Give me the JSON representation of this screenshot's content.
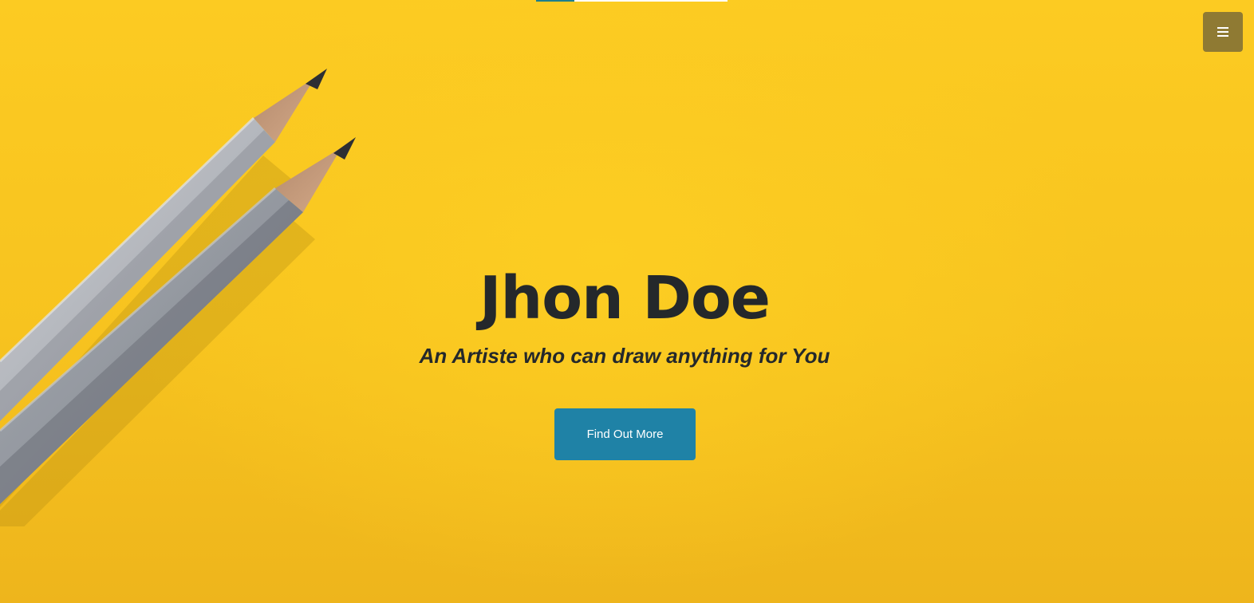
{
  "hero": {
    "title": "Jhon Doe",
    "subtitle": "An Artiste who can draw anything for You",
    "cta_label": "Find Out More",
    "background_image": "yellow-paper-with-two-pencils"
  },
  "nav": {
    "menu_icon": "hamburger-menu-icon"
  },
  "colors": {
    "background": "#f8c51f",
    "text": "#24282b",
    "cta": "#1f82a6",
    "menu_button": "#8f7a33"
  }
}
